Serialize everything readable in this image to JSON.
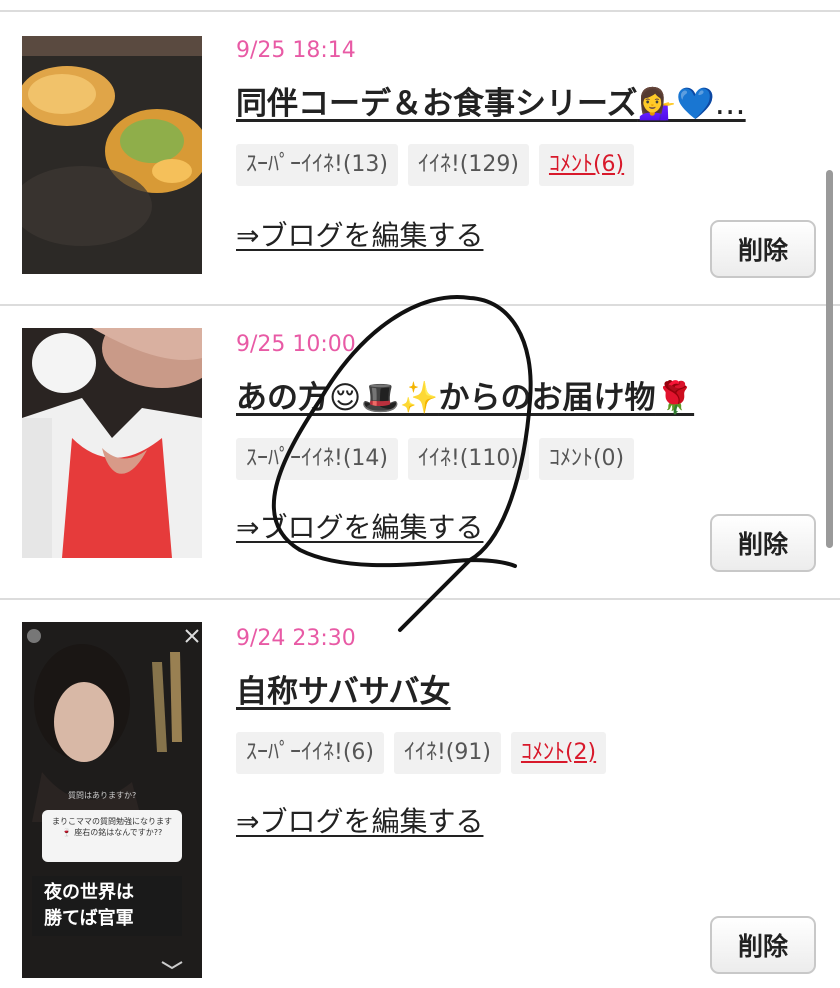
{
  "entries": [
    {
      "date": "9/25 18:14",
      "title": "同伴コーデ＆お食事シリーズ",
      "title_emoji": "💁‍♀️💙…",
      "super_like": "ｽｰﾊﾟｰｲｲﾈ!(13)",
      "like": "ｲｲﾈ!(129)",
      "comment": "ｺﾒﾝﾄ(6)",
      "comment_active": true,
      "edit_link": "⇒ブログを編集する",
      "delete_label": "削除"
    },
    {
      "date": "9/25 10:00",
      "title": "あの方",
      "title_emoji": "😌🎩✨",
      "title_tail": "からのお届け物",
      "title_tail_emoji": "🌹",
      "super_like": "ｽｰﾊﾟｰｲｲﾈ!(14)",
      "like": "ｲｲﾈ!(110)",
      "comment": "ｺﾒﾝﾄ(0)",
      "comment_active": false,
      "edit_link": "⇒ブログを編集する",
      "delete_label": "削除"
    },
    {
      "date": "9/24 23:30",
      "title": "自称サバサバ女",
      "super_like": "ｽｰﾊﾟｰｲｲﾈ!(6)",
      "like": "ｲｲﾈ!(91)",
      "comment": "ｺﾒﾝﾄ(2)",
      "comment_active": true,
      "edit_link": "⇒ブログを編集する",
      "delete_label": "削除",
      "thumb_text": {
        "question": "質問はありますか?",
        "bubble": "まりこママの質問勉強になります🍷 座右の銘はなんですか??",
        "caption_1": "夜の世界は",
        "caption_2": "勝てば官軍"
      }
    }
  ],
  "colors": {
    "date": "#e85aa5",
    "comment_active": "#d8192b",
    "chip_bg": "#f1f1f1",
    "divider": "#dcdcdc"
  },
  "icons": [
    "food-photo",
    "portrait-photo",
    "story-screenshot",
    "pen-annotation"
  ]
}
